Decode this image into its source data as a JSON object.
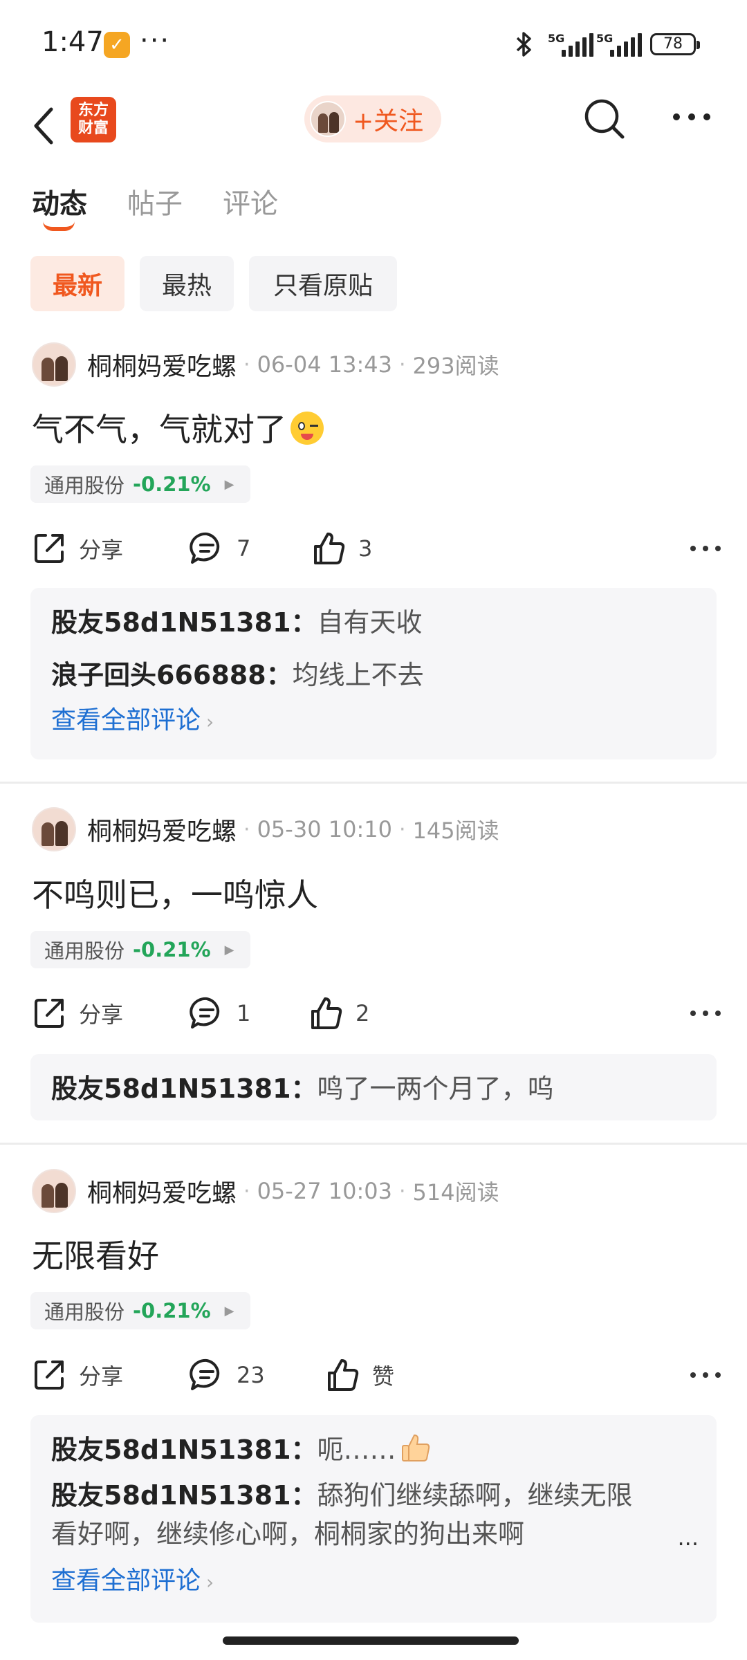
{
  "status_bar": {
    "time": "1:47",
    "dots": "···",
    "network_1": "5G",
    "network_2": "5G",
    "battery": "78"
  },
  "header": {
    "logo_line1": "东方",
    "logo_line2": "财富",
    "follow_label": "+关注"
  },
  "tabs": [
    {
      "label": "动态",
      "active": true
    },
    {
      "label": "帖子",
      "active": false
    },
    {
      "label": "评论",
      "active": false
    }
  ],
  "filters": [
    {
      "label": "最新",
      "active": true
    },
    {
      "label": "最热",
      "active": false
    },
    {
      "label": "只看原贴",
      "active": false
    }
  ],
  "posts": [
    {
      "author": "桐桐妈爱吃螺",
      "date": "06-04 13:43",
      "reads": "293阅读",
      "text": "气不气，气就对了",
      "stock_name": "通用股份",
      "stock_change": "-0.21%",
      "share_label": "分享",
      "comment_count": "7",
      "like_count": "3",
      "comments": [
        {
          "user": "股友58d1N51381：",
          "text": "自有天收"
        },
        {
          "user": "浪子回头666888：",
          "text": "均线上不去"
        }
      ],
      "view_all": "查看全部评论"
    },
    {
      "author": "桐桐妈爱吃螺",
      "date": "05-30 10:10",
      "reads": "145阅读",
      "text": "不鸣则已，一鸣惊人",
      "stock_name": "通用股份",
      "stock_change": "-0.21%",
      "share_label": "分享",
      "comment_count": "1",
      "like_count": "2",
      "comments": [
        {
          "user": "股友58d1N51381：",
          "text": "鸣了一两个月了，呜"
        }
      ]
    },
    {
      "author": "桐桐妈爱吃螺",
      "date": "05-27 10:03",
      "reads": "514阅读",
      "text": "无限看好",
      "stock_name": "通用股份",
      "stock_change": "-0.21%",
      "share_label": "分享",
      "comment_count": "23",
      "like_count": "赞",
      "comments": [
        {
          "user": "股友58d1N51381：",
          "text": "呃……"
        },
        {
          "user": "股友58d1N51381：",
          "text": "舔狗们继续舔啊，继续无限看好啊，继续修心啊，桐桐家的狗出来啊"
        }
      ],
      "truncation": "...",
      "view_all": "查看全部评论"
    }
  ],
  "colors": {
    "accent": "#f0581f",
    "stock_down": "#23a559",
    "link": "#1e6fd2"
  },
  "icons": [
    "back-arrow-icon",
    "search-icon",
    "more-icon",
    "share-icon",
    "comment-icon",
    "thumbs-up-icon",
    "wink-emoji-icon",
    "thumbs-up-emoji-icon",
    "bluetooth-icon",
    "signal-icon",
    "battery-icon"
  ]
}
